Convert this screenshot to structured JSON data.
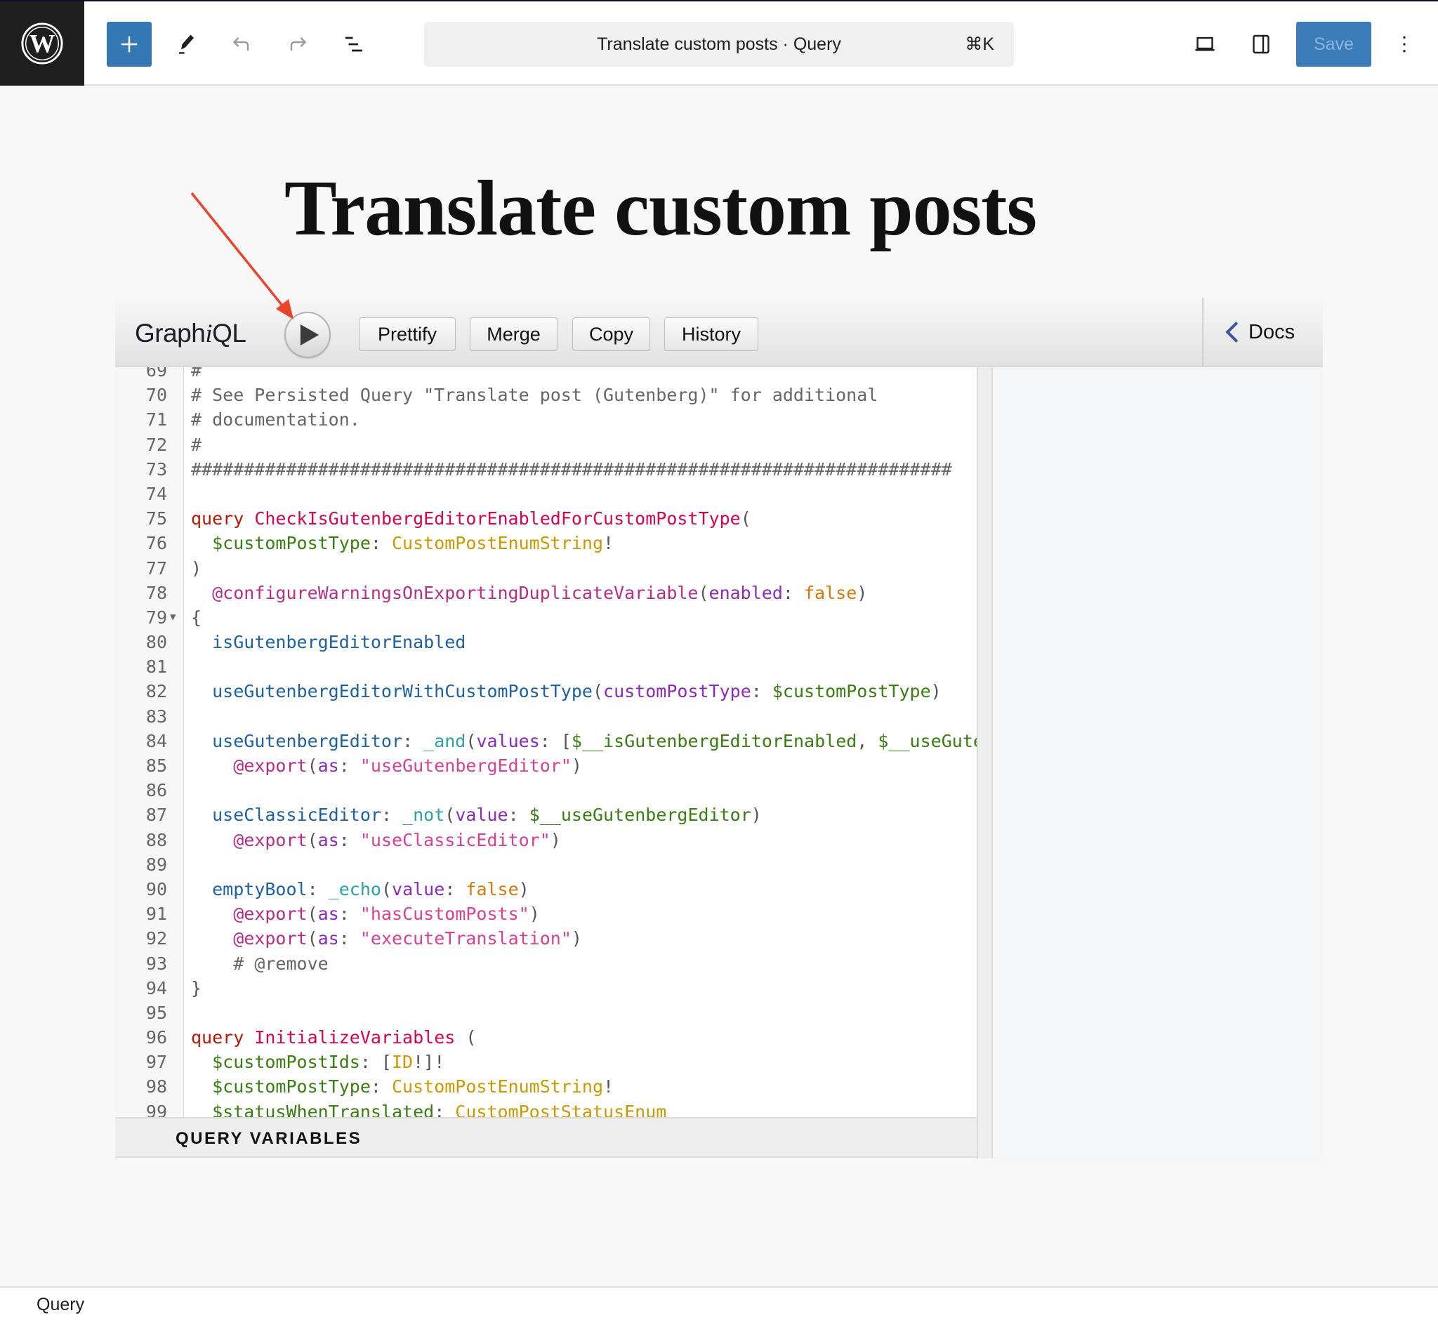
{
  "header": {
    "logo_icon": "wordpress-logo-icon",
    "add_icon": "plus-icon",
    "tools_icon": "pencil-icon",
    "undo_icon": "undo-icon",
    "redo_icon": "redo-icon",
    "list_view_icon": "list-view-icon",
    "command_palette": {
      "title": "Translate custom posts · Query",
      "shortcut": "⌘K"
    },
    "preview_icon": "laptop-icon",
    "settings_icon": "sidebar-toggle-icon",
    "save_label": "Save",
    "options_icon": "more-vertical-icon",
    "accent_color": "#3377b3"
  },
  "post": {
    "title": "Translate custom posts"
  },
  "annotation": {
    "arrow_color": "#e8452c",
    "points_to": "run-button"
  },
  "graphiql": {
    "logo_prefix": "Graph",
    "logo_i": "i",
    "logo_suffix": "QL",
    "run_icon": "play-icon",
    "buttons": {
      "prettify": "Prettify",
      "merge": "Merge",
      "copy": "Copy",
      "history": "History"
    },
    "docs_label": "Docs",
    "docs_icon": "chevron-left-icon",
    "query_variables_label": "QUERY VARIABLES",
    "editor": {
      "lines": [
        {
          "n": "69",
          "tokens": [
            [
              "c-comment",
              "#"
            ]
          ]
        },
        {
          "n": "70",
          "tokens": [
            [
              "c-comment",
              "# See Persisted Query \"Translate post (Gutenberg)\" for additional"
            ]
          ]
        },
        {
          "n": "71",
          "tokens": [
            [
              "c-comment",
              "# documentation."
            ]
          ]
        },
        {
          "n": "72",
          "tokens": [
            [
              "c-comment",
              "#"
            ]
          ]
        },
        {
          "n": "73",
          "tokens": [
            [
              "c-comment",
              "########################################################################"
            ]
          ]
        },
        {
          "n": "74",
          "tokens": []
        },
        {
          "n": "75",
          "tokens": [
            [
              "c-keyword",
              "query"
            ],
            [
              "",
              " "
            ],
            [
              "c-def",
              "CheckIsGutenbergEditorEnabledForCustomPostType"
            ],
            [
              "c-punct",
              "("
            ]
          ]
        },
        {
          "n": "76",
          "tokens": [
            [
              "",
              "  "
            ],
            [
              "c-variable",
              "$customPostType"
            ],
            [
              "c-punct",
              ": "
            ],
            [
              "c-type",
              "CustomPostEnumString"
            ],
            [
              "c-punct",
              "!"
            ]
          ]
        },
        {
          "n": "77",
          "tokens": [
            [
              "c-punct",
              ")"
            ]
          ]
        },
        {
          "n": "78",
          "tokens": [
            [
              "",
              "  "
            ],
            [
              "c-directive",
              "@configureWarningsOnExportingDuplicateVariable"
            ],
            [
              "c-punct",
              "("
            ],
            [
              "c-attribute",
              "enabled"
            ],
            [
              "c-punct",
              ": "
            ],
            [
              "c-atom",
              "false"
            ],
            [
              "c-punct",
              ")"
            ]
          ]
        },
        {
          "n": "79",
          "fold": true,
          "tokens": [
            [
              "c-punct",
              "{"
            ]
          ]
        },
        {
          "n": "80",
          "tokens": [
            [
              "",
              "  "
            ],
            [
              "c-property",
              "isGutenbergEditorEnabled"
            ]
          ]
        },
        {
          "n": "81",
          "tokens": []
        },
        {
          "n": "82",
          "tokens": [
            [
              "",
              "  "
            ],
            [
              "c-property",
              "useGutenbergEditorWithCustomPostType"
            ],
            [
              "c-punct",
              "("
            ],
            [
              "c-attribute",
              "customPostType"
            ],
            [
              "c-punct",
              ": "
            ],
            [
              "c-variable",
              "$customPostType"
            ],
            [
              "c-punct",
              ")"
            ]
          ]
        },
        {
          "n": "83",
          "tokens": []
        },
        {
          "n": "84",
          "tokens": [
            [
              "",
              "  "
            ],
            [
              "c-property",
              "useGutenbergEditor"
            ],
            [
              "c-punct",
              ": "
            ],
            [
              "c-builtin",
              "_and"
            ],
            [
              "c-punct",
              "("
            ],
            [
              "c-attribute",
              "values"
            ],
            [
              "c-punct",
              ": ["
            ],
            [
              "c-variable",
              "$__isGutenbergEditorEnabled"
            ],
            [
              "c-punct",
              ", "
            ],
            [
              "c-variable",
              "$__useGutenbergEditorWithCustomPostType"
            ],
            [
              "c-punct",
              "])"
            ]
          ]
        },
        {
          "n": "85",
          "tokens": [
            [
              "",
              "    "
            ],
            [
              "c-directive",
              "@export"
            ],
            [
              "c-punct",
              "("
            ],
            [
              "c-attribute",
              "as"
            ],
            [
              "c-punct",
              ": "
            ],
            [
              "c-string",
              "\"useGutenbergEditor\""
            ],
            [
              "c-punct",
              ")"
            ]
          ]
        },
        {
          "n": "86",
          "tokens": []
        },
        {
          "n": "87",
          "tokens": [
            [
              "",
              "  "
            ],
            [
              "c-property",
              "useClassicEditor"
            ],
            [
              "c-punct",
              ": "
            ],
            [
              "c-builtin",
              "_not"
            ],
            [
              "c-punct",
              "("
            ],
            [
              "c-attribute",
              "value"
            ],
            [
              "c-punct",
              ": "
            ],
            [
              "c-variable",
              "$__useGutenbergEditor"
            ],
            [
              "c-punct",
              ")"
            ]
          ]
        },
        {
          "n": "88",
          "tokens": [
            [
              "",
              "    "
            ],
            [
              "c-directive",
              "@export"
            ],
            [
              "c-punct",
              "("
            ],
            [
              "c-attribute",
              "as"
            ],
            [
              "c-punct",
              ": "
            ],
            [
              "c-string",
              "\"useClassicEditor\""
            ],
            [
              "c-punct",
              ")"
            ]
          ]
        },
        {
          "n": "89",
          "tokens": []
        },
        {
          "n": "90",
          "tokens": [
            [
              "",
              "  "
            ],
            [
              "c-property",
              "emptyBool"
            ],
            [
              "c-punct",
              ": "
            ],
            [
              "c-builtin",
              "_echo"
            ],
            [
              "c-punct",
              "("
            ],
            [
              "c-attribute",
              "value"
            ],
            [
              "c-punct",
              ": "
            ],
            [
              "c-atom",
              "false"
            ],
            [
              "c-punct",
              ")"
            ]
          ]
        },
        {
          "n": "91",
          "tokens": [
            [
              "",
              "    "
            ],
            [
              "c-directive",
              "@export"
            ],
            [
              "c-punct",
              "("
            ],
            [
              "c-attribute",
              "as"
            ],
            [
              "c-punct",
              ": "
            ],
            [
              "c-string",
              "\"hasCustomPosts\""
            ],
            [
              "c-punct",
              ")"
            ]
          ]
        },
        {
          "n": "92",
          "tokens": [
            [
              "",
              "    "
            ],
            [
              "c-directive",
              "@export"
            ],
            [
              "c-punct",
              "("
            ],
            [
              "c-attribute",
              "as"
            ],
            [
              "c-punct",
              ": "
            ],
            [
              "c-string",
              "\"executeTranslation\""
            ],
            [
              "c-punct",
              ")"
            ]
          ]
        },
        {
          "n": "93",
          "tokens": [
            [
              "",
              "    "
            ],
            [
              "c-comment",
              "# @remove"
            ]
          ]
        },
        {
          "n": "94",
          "tokens": [
            [
              "c-punct",
              "}"
            ]
          ]
        },
        {
          "n": "95",
          "tokens": []
        },
        {
          "n": "96",
          "tokens": [
            [
              "c-keyword",
              "query"
            ],
            [
              "",
              " "
            ],
            [
              "c-def",
              "InitializeVariables"
            ],
            [
              "c-punct",
              " ("
            ]
          ]
        },
        {
          "n": "97",
          "tokens": [
            [
              "",
              "  "
            ],
            [
              "c-variable",
              "$customPostIds"
            ],
            [
              "c-punct",
              ": ["
            ],
            [
              "c-type",
              "ID"
            ],
            [
              "c-punct",
              "!]!"
            ]
          ]
        },
        {
          "n": "98",
          "tokens": [
            [
              "",
              "  "
            ],
            [
              "c-variable",
              "$customPostType"
            ],
            [
              "c-punct",
              ": "
            ],
            [
              "c-type",
              "CustomPostEnumString"
            ],
            [
              "c-punct",
              "!"
            ]
          ]
        },
        {
          "n": "99",
          "tokens": [
            [
              "",
              "  "
            ],
            [
              "c-variable",
              "$statusWhenTranslated"
            ],
            [
              "c-punct",
              ": "
            ],
            [
              "c-type",
              "CustomPostStatusEnum"
            ]
          ]
        }
      ]
    }
  },
  "footer": {
    "breadcrumb": "Query"
  }
}
